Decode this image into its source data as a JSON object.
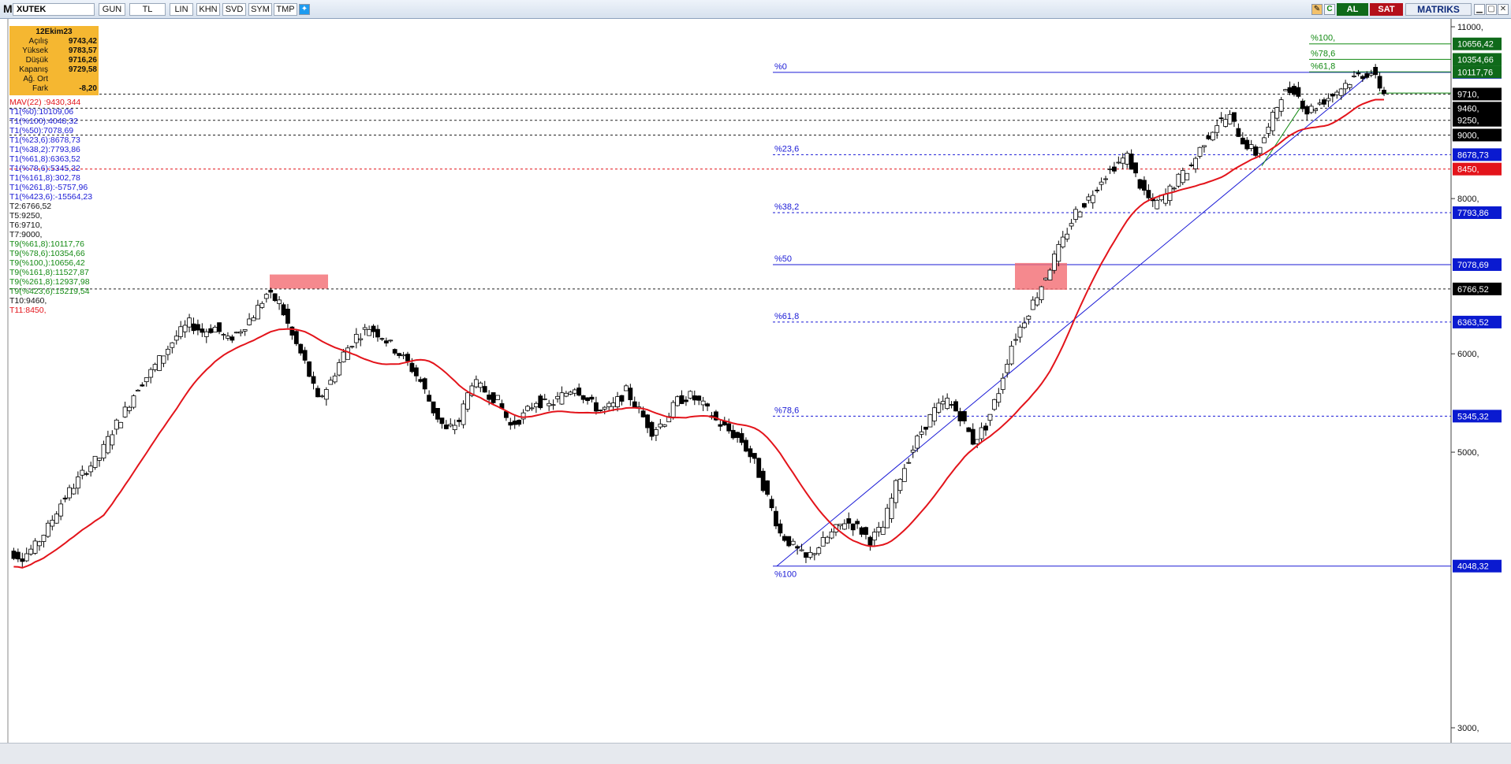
{
  "toolbar": {
    "logo": "M",
    "symbol": "XUTEK",
    "buttons": [
      "GUN",
      "TL",
      "LIN",
      "KHN",
      "SVD",
      "SYM",
      "TMP"
    ],
    "buy_label": "AL",
    "sell_label": "SAT",
    "brand": "MATRIKS",
    "icons": [
      "pencil-icon",
      "refresh-icon",
      "twitter-icon"
    ]
  },
  "info_box": {
    "date": "12Ekim23",
    "rows": [
      {
        "label": "Açılış",
        "value": "9743,42"
      },
      {
        "label": "Yüksek",
        "value": "9783,57"
      },
      {
        "label": "Düşük",
        "value": "9716,26"
      },
      {
        "label": "Kapanış",
        "value": "9729,58"
      },
      {
        "label": "Ağ. Ort",
        "value": ""
      },
      {
        "label": "Fark",
        "value": "-8,20"
      }
    ]
  },
  "legend": [
    {
      "text": "MAV(22)          :9430,344",
      "color": "#e3141b"
    },
    {
      "text": "T1(%0):10109,06",
      "color": "#1a1ad6"
    },
    {
      "text": "T1(%100):4048,32",
      "color": "#1a1ad6"
    },
    {
      "text": "T1(%50):7078,69",
      "color": "#1a1ad6"
    },
    {
      "text": "T1(%23,6):8678,73",
      "color": "#1a1ad6"
    },
    {
      "text": "T1(%38,2):7793,86",
      "color": "#1a1ad6"
    },
    {
      "text": "T1(%61,8):6363,52",
      "color": "#1a1ad6"
    },
    {
      "text": "T1(%78,6):5345,32",
      "color": "#1a1ad6"
    },
    {
      "text": "T1(%161,8):302,78",
      "color": "#1a1ad6"
    },
    {
      "text": "T1(%261,8):-5757,96",
      "color": "#1a1ad6"
    },
    {
      "text": "T1(%423,6):-15564,23",
      "color": "#1a1ad6"
    },
    {
      "text": "T2:6766,52",
      "color": "#111111"
    },
    {
      "text": "T5:9250,",
      "color": "#111111"
    },
    {
      "text": "T6:9710,",
      "color": "#111111"
    },
    {
      "text": "T7:9000,",
      "color": "#111111"
    },
    {
      "text": "T9(%61,8):10117,76",
      "color": "#138a13"
    },
    {
      "text": "T9(%78,6):10354,66",
      "color": "#138a13"
    },
    {
      "text": "T9(%100,):10656,42",
      "color": "#138a13"
    },
    {
      "text": "T9(%161,8):11527,87",
      "color": "#138a13"
    },
    {
      "text": "T9(%261,8):12937,98",
      "color": "#138a13"
    },
    {
      "text": "T9(%423,6):15219,54",
      "color": "#138a13"
    },
    {
      "text": "T10:9460,",
      "color": "#111111"
    },
    {
      "text": "T11:8450,",
      "color": "#e3141b"
    }
  ],
  "chart_data": {
    "type": "candlestick",
    "symbol": "XUTEK",
    "y_axis": {
      "min": 3000,
      "max": 11000,
      "ticks": [
        "3000,",
        "5000,",
        "6000,",
        "8000,",
        "11000,"
      ]
    },
    "fib_levels": [
      {
        "label": "%0",
        "value": 10109.06,
        "tag": "10117,76"
      },
      {
        "label": "%23,6",
        "value": 8678.73,
        "tag": "8678,73"
      },
      {
        "label": "%38,2",
        "value": 7793.86,
        "tag": "7793,86"
      },
      {
        "label": "%50",
        "value": 7078.69,
        "tag": "7078,69"
      },
      {
        "label": "%61,8",
        "value": 6363.52,
        "tag": "6363,52"
      },
      {
        "label": "%78,6",
        "value": 5345.32,
        "tag": "5345,32"
      },
      {
        "label": "%100",
        "value": 4048.32,
        "tag": "4048,32"
      }
    ],
    "projection_levels": [
      {
        "label": "%100,",
        "value": 10656.42,
        "tag": "10656,42"
      },
      {
        "label": "%78,6",
        "value": 10354.66,
        "tag": "10354,66"
      },
      {
        "label": "%61,8",
        "value": 10117.76,
        "tag": "10117,76"
      }
    ],
    "horizontal_levels": [
      {
        "value": 9710,
        "tag": "9710,"
      },
      {
        "value": 9460,
        "tag": "9460,"
      },
      {
        "value": 9250,
        "tag": "9250,"
      },
      {
        "value": 9000,
        "tag": "9000,"
      },
      {
        "value": 8450,
        "tag": "8450,"
      },
      {
        "value": 6766.52,
        "tag": "6766,52"
      }
    ],
    "fib_start_label": "%0",
    "fib_end_label": "%100",
    "ma_period": 22,
    "ohlc_path": [
      4150,
      4120,
      4200,
      4350,
      4550,
      4700,
      4850,
      4950,
      5200,
      5400,
      5650,
      5800,
      6000,
      6200,
      6350,
      6250,
      6300,
      6150,
      6280,
      6450,
      6700,
      6600,
      6200,
      5900,
      5500,
      5700,
      6000,
      6200,
      6300,
      6200,
      6050,
      5900,
      5700,
      5400,
      5200,
      5300,
      5700,
      5600,
      5500,
      5250,
      5350,
      5500,
      5450,
      5550,
      5650,
      5500,
      5400,
      5450,
      5600,
      5400,
      5200,
      5300,
      5500,
      5550,
      5450,
      5300,
      5200,
      5100,
      4900,
      4600,
      4300,
      4200,
      4100,
      4200,
      4300,
      4400,
      4350,
      4250,
      4350,
      4700,
      4950,
      5200,
      5400,
      5500,
      5350,
      5100,
      5250,
      5600,
      6100,
      6400,
      6700,
      7050,
      7400,
      7800,
      8000,
      8300,
      8500,
      8650,
      8200,
      7900,
      8050,
      8300,
      8500,
      8900,
      9200,
      9300,
      8900,
      8700,
      9100,
      9700,
      9800,
      9400,
      9550,
      9700,
      9900,
      10050,
      10109,
      9729
    ]
  }
}
